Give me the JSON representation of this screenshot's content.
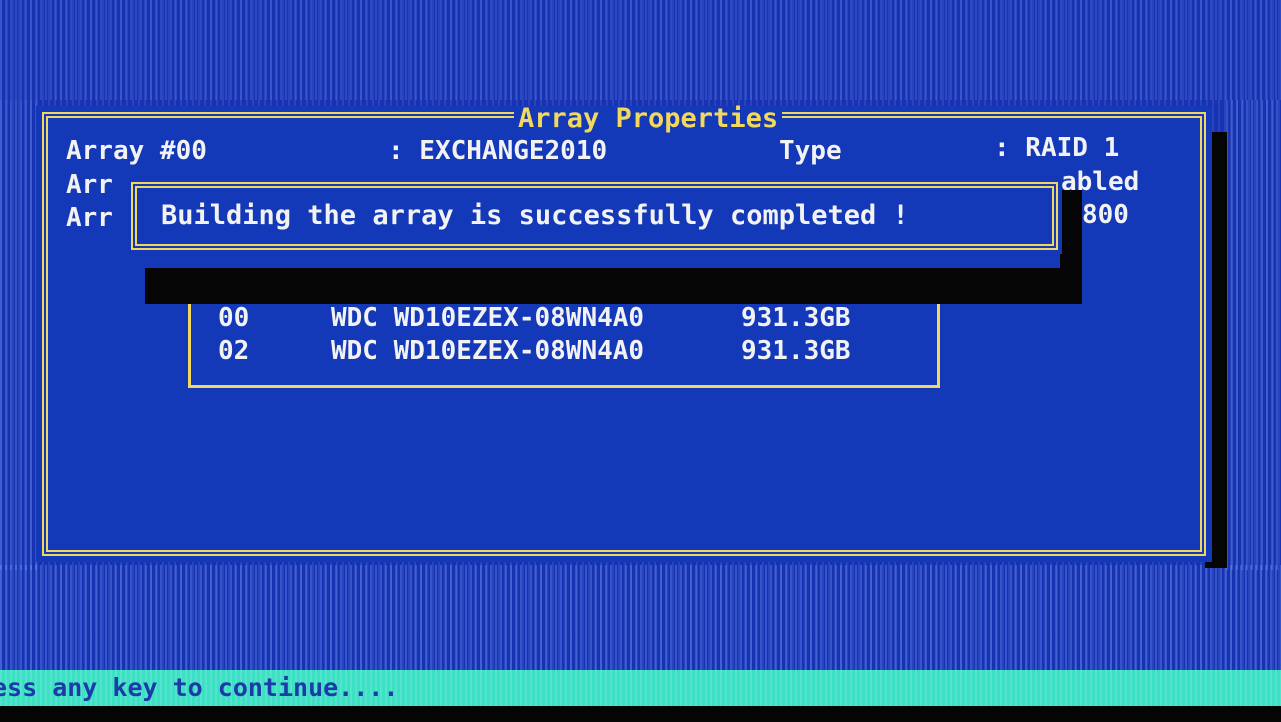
{
  "window": {
    "title": "Array Properties",
    "array_label": "Array #00",
    "array_name": ": EXCHANGE2010",
    "type_label": "Type",
    "type_value": ": RAID 1",
    "row2_left_fragment": "Arr",
    "row2_right_fragment": "abled",
    "row3_left_fragment": "Arr",
    "row3_right_fragment": "800"
  },
  "disks": [
    {
      "id": "00",
      "model": "WDC WD10EZEX-08WN4A0",
      "size": "931.3GB"
    },
    {
      "id": "02",
      "model": "WDC WD10EZEX-08WN4A0",
      "size": "931.3GB"
    }
  ],
  "popup": {
    "message": "Building the array is successfully completed !"
  },
  "status_bar": {
    "text": "ess any key to continue...."
  },
  "colors": {
    "background": "#1832b4",
    "window_bg": "#1338b8",
    "border": "#f0d860",
    "title_text": "#f4d85c",
    "body_text": "#f2f2f2",
    "status_bg": "#3ce0c4",
    "status_text": "#1c3aa8"
  }
}
